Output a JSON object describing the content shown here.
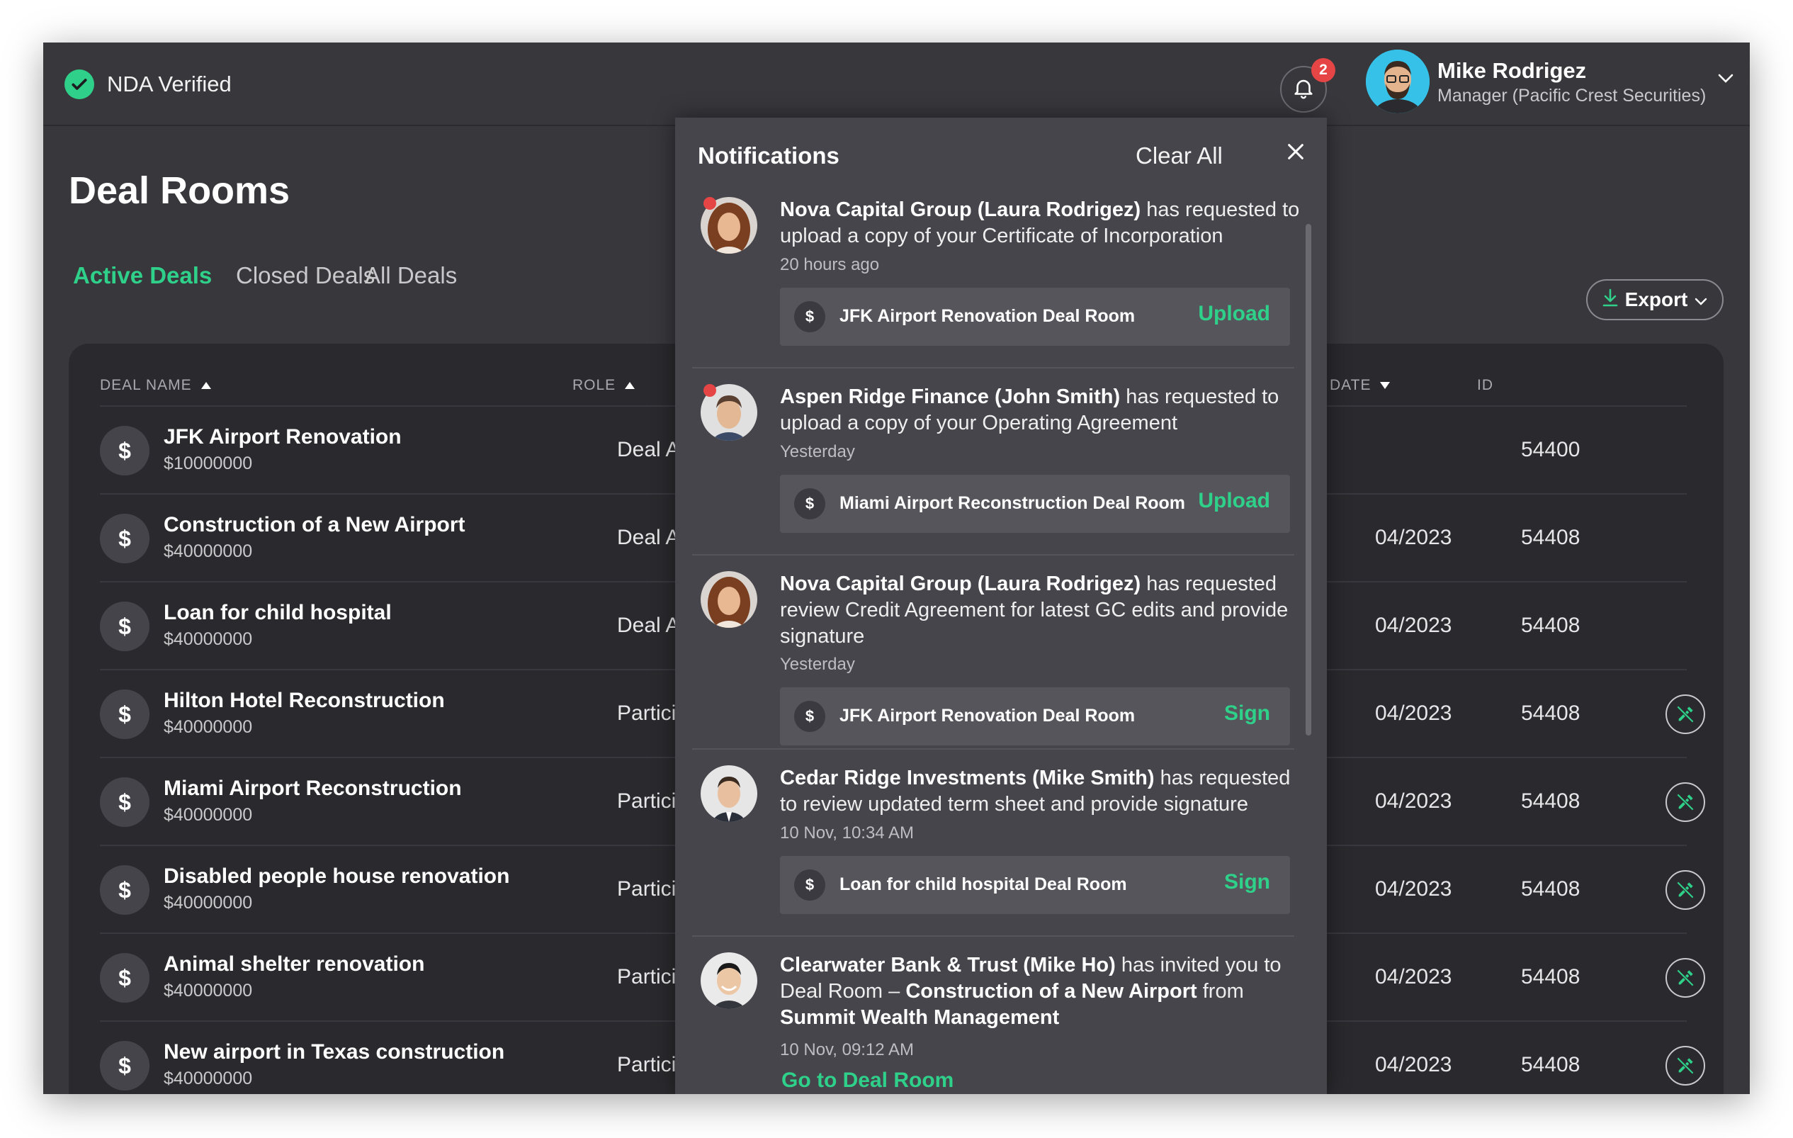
{
  "topbar": {
    "nda_label": "NDA Verified",
    "notification_count": "2",
    "user_name": "Mike Rodrigez",
    "user_role": "Manager (Pacific Crest Securities)"
  },
  "page": {
    "title": "Deal Rooms",
    "tabs": [
      "Active Deals",
      "Closed Deals",
      "All Deals"
    ],
    "export_label": "Export"
  },
  "table": {
    "headers": {
      "deal_name": "DEAL NAME",
      "role": "ROLE",
      "date": "DATE",
      "id": "ID"
    },
    "rows": [
      {
        "name": "JFK Airport Renovation",
        "amount": "$10000000",
        "role": "Deal Arran",
        "date": "",
        "id": "54400",
        "has_action": false
      },
      {
        "name": "Construction of a New Airport",
        "amount": "$40000000",
        "role": "Deal Arran",
        "date": "04/2023",
        "id": "54408",
        "has_action": false
      },
      {
        "name": "Loan for child hospital",
        "amount": "$40000000",
        "role": "Deal Arran",
        "date": "04/2023",
        "id": "54408",
        "has_action": false
      },
      {
        "name": "Hilton Hotel Reconstruction",
        "amount": "$40000000",
        "role": "Participant",
        "date": "04/2023",
        "id": "54408",
        "has_action": true
      },
      {
        "name": "Miami Airport Reconstruction",
        "amount": "$40000000",
        "role": "Participant",
        "date": "04/2023",
        "id": "54408",
        "has_action": true
      },
      {
        "name": "Disabled people house renovation",
        "amount": "$40000000",
        "role": "Participant",
        "date": "04/2023",
        "id": "54408",
        "has_action": true
      },
      {
        "name": "Animal shelter renovation",
        "amount": "$40000000",
        "role": "Participant",
        "date": "04/2023",
        "id": "54408",
        "has_action": true
      },
      {
        "name": "New airport in Texas construction",
        "amount": "$40000000",
        "role": "Participant",
        "date": "04/2023",
        "id": "54408",
        "has_action": true
      }
    ]
  },
  "notifications": {
    "title": "Notifications",
    "clear_all": "Clear All",
    "items": [
      {
        "sender": "Nova Capital Group (Laura Rodrigez)",
        "message": " has requested to upload  a copy of your Certificate of Incorporation",
        "time": "20 hours ago",
        "deal_room": "JFK Airport Renovation Deal Room",
        "action": "Upload"
      },
      {
        "sender": "Aspen Ridge Finance (John Smith)",
        "message": " has requested to upload  a copy of your Operating Agreement",
        "time": "Yesterday",
        "deal_room": "Miami Airport Reconstruction Deal Room",
        "action": "Upload"
      },
      {
        "sender": "Nova Capital Group (Laura Rodrigez)",
        "message": " has requested review Credit Agreement for latest GC edits and provide signature",
        "time": "Yesterday",
        "deal_room": "JFK Airport Renovation Deal Room",
        "action": "Sign"
      },
      {
        "sender": "Cedar Ridge Investments (Mike Smith)",
        "message": " has requested to review updated term sheet and provide signature",
        "time": "10 Nov, 10:34 AM",
        "deal_room": "Loan for child hospital Deal Room",
        "action": "Sign"
      },
      {
        "sender": "Clearwater Bank & Trust (Mike Ho)",
        "message_1": " has invited you to Deal Room – ",
        "deal_name": "Construction of a New Airport",
        "message_2": " from ",
        "from_org": "Summit Wealth Management",
        "time": "10 Nov, 09:12 AM",
        "link": "Go to Deal Room"
      }
    ]
  },
  "icons": {
    "nda": "check-circle-icon",
    "bell": "bell-icon",
    "chevron": "chevron-down-icon",
    "export": "download-icon",
    "close": "close-icon",
    "deal": "dollar-icon",
    "row_action": "no-signature-icon"
  },
  "colors": {
    "accent": "#2fd08a",
    "badge": "#e64545",
    "background": "#37373c",
    "panel": "#45454b",
    "table": "#2a2a2e"
  }
}
